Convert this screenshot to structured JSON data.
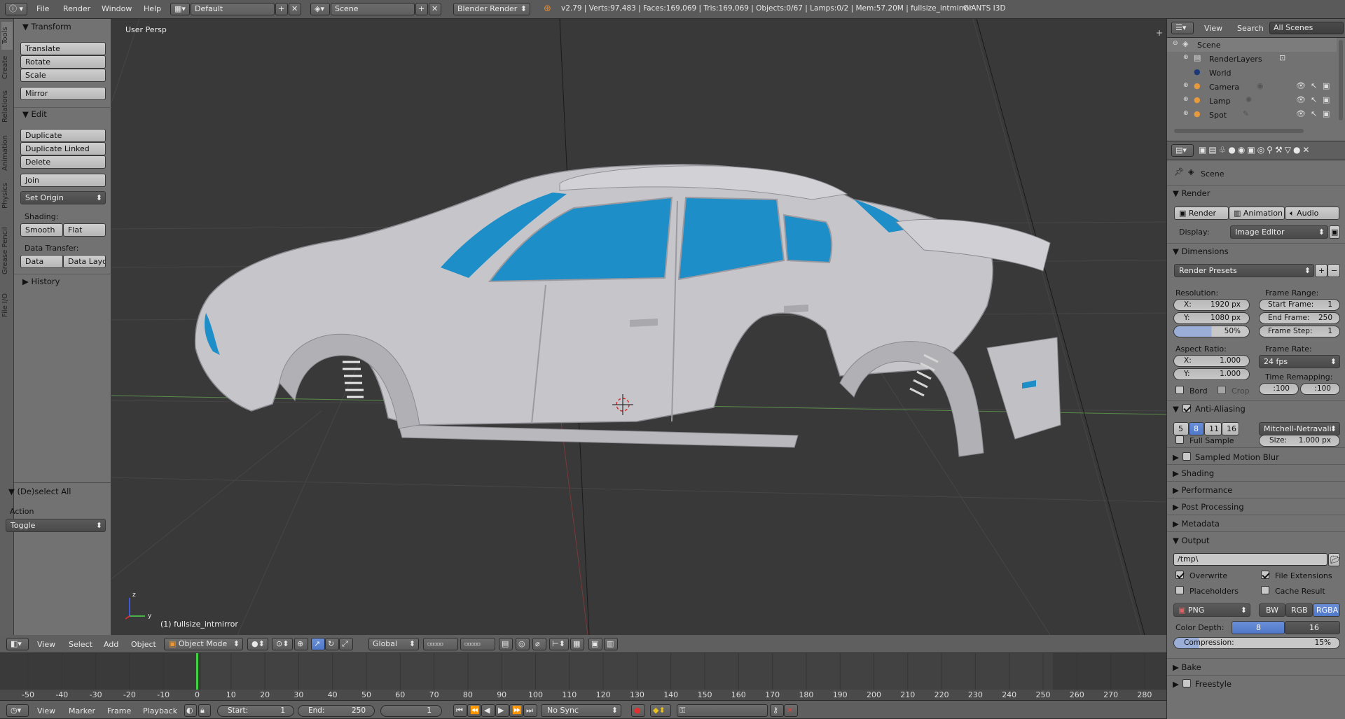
{
  "topbar": {
    "menus": [
      "File",
      "Render",
      "Window",
      "Help"
    ],
    "layout": "Default",
    "scene": "Scene",
    "engine": "Blender Render",
    "stats": "v2.79 | Verts:97,483 | Faces:169,069 | Tris:169,069 | Objects:0/67 | Lamps:0/2 | Mem:57.20M | fullsize_intmirror",
    "addon": "GIANTS I3D"
  },
  "toolshelf": {
    "tabs": [
      "Tools",
      "Create",
      "Relations",
      "Animation",
      "Physics",
      "Grease Pencil",
      "File I/O"
    ],
    "transform": {
      "title": "Transform",
      "buttons": [
        "Translate",
        "Rotate",
        "Scale",
        "Mirror"
      ]
    },
    "edit": {
      "title": "Edit",
      "buttons": [
        "Duplicate",
        "Duplicate Linked",
        "Delete",
        "Join"
      ],
      "set_origin": "Set Origin",
      "shading_label": "Shading:",
      "smooth": "Smooth",
      "flat": "Flat",
      "data_transfer_label": "Data Transfer:",
      "data": "Data",
      "data_layo": "Data Layo"
    },
    "history": "History"
  },
  "operator": {
    "title": "(De)select All",
    "action_label": "Action",
    "action_value": "Toggle"
  },
  "viewport": {
    "view_label": "User Persp",
    "object_label": "(1) fullsize_intmirror",
    "axis_z": "z",
    "axis_y": "y",
    "glass_color": "#1e8ec8",
    "body_color": "#c9c9cd"
  },
  "view3d_header": {
    "menus": [
      "View",
      "Select",
      "Add",
      "Object"
    ],
    "mode": "Object Mode",
    "orientation": "Global"
  },
  "timeline": {
    "ticks": [
      "-50",
      "-40",
      "-30",
      "-20",
      "-10",
      "0",
      "10",
      "20",
      "30",
      "40",
      "50",
      "60",
      "70",
      "80",
      "90",
      "100",
      "110",
      "120",
      "130",
      "140",
      "150",
      "160",
      "170",
      "180",
      "190",
      "200",
      "210",
      "220",
      "230",
      "240",
      "250",
      "260",
      "270",
      "280"
    ],
    "current_frame_color": "#3fd43f",
    "menus": [
      "View",
      "Marker",
      "Frame",
      "Playback"
    ],
    "start": "Start:",
    "start_val": "1",
    "end": "End:",
    "end_val": "250",
    "current": "1",
    "sync": "No Sync"
  },
  "outliner": {
    "header": {
      "view": "View",
      "search": "Search",
      "scenes": "All Scenes"
    },
    "items": [
      "Scene",
      "RenderLayers",
      "World",
      "Camera",
      "Lamp",
      "Spot"
    ]
  },
  "properties": {
    "context": "Scene",
    "render": {
      "title": "Render",
      "render_btn": "Render",
      "animation_btn": "Animation",
      "audio_btn": "Audio",
      "display_label": "Display:",
      "display_value": "Image Editor"
    },
    "dimensions": {
      "title": "Dimensions",
      "presets": "Render Presets",
      "resolution_label": "Resolution:",
      "res_x": "X:",
      "res_x_val": "1920 px",
      "res_y": "Y:",
      "res_y_val": "1080 px",
      "res_pct": "50%",
      "frame_range_label": "Frame Range:",
      "start_frame": "Start Frame:",
      "start_frame_val": "1",
      "end_frame": "End Frame:",
      "end_frame_val": "250",
      "frame_step": "Frame Step:",
      "frame_step_val": "1",
      "aspect_label": "Aspect Ratio:",
      "asp_x": "X:",
      "asp_x_val": "1.000",
      "asp_y": "Y:",
      "asp_y_val": "1.000",
      "frame_rate_label": "Frame Rate:",
      "frame_rate": "24 fps",
      "time_remap_label": "Time Remapping:",
      "remap_old": ":100",
      "remap_new": ":100",
      "bord": "Bord",
      "crop": "Crop"
    },
    "antialiasing": {
      "title": "Anti-Aliasing",
      "samples": [
        "5",
        "8",
        "11",
        "16"
      ],
      "filter": "Mitchell-Netravali",
      "full_sample": "Full Sample",
      "size_label": "Size:",
      "size_val": "1.000 px"
    },
    "collapsed_1": [
      "Sampled Motion Blur",
      "Shading",
      "Performance",
      "Post Processing",
      "Metadata"
    ],
    "output": {
      "title": "Output",
      "path": "/tmp\\",
      "overwrite": "Overwrite",
      "file_extensions": "File Extensions",
      "placeholders": "Placeholders",
      "cache_result": "Cache Result",
      "format": "PNG",
      "bw": "BW",
      "rgb": "RGB",
      "rgba": "RGBA",
      "color_depth_label": "Color Depth:",
      "depth_8": "8",
      "depth_16": "16",
      "compression_label": "Compression:",
      "compression_val": "15%"
    },
    "collapsed_2": [
      "Bake",
      "Freestyle"
    ]
  }
}
